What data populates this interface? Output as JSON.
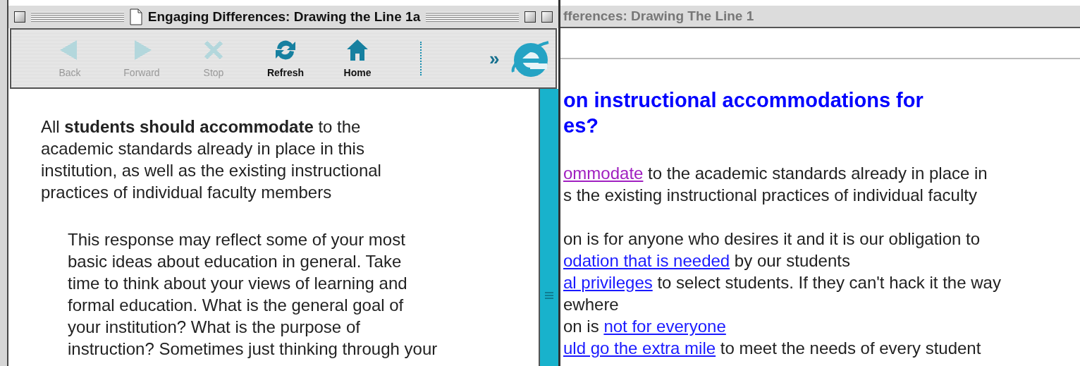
{
  "front_window": {
    "title": "Engaging Differences: Drawing the Line 1a",
    "toolbar": [
      {
        "kind": "back",
        "label": "Back",
        "disabled": true
      },
      {
        "kind": "forward",
        "label": "Forward",
        "disabled": true
      },
      {
        "kind": "stop",
        "label": "Stop",
        "disabled": true
      },
      {
        "kind": "refresh",
        "label": "Refresh",
        "disabled": false
      },
      {
        "kind": "home",
        "label": "Home",
        "disabled": false
      }
    ],
    "overflow": "»",
    "statement_lines": [
      "All **students should accommodate** to the",
      "academic standards already in place in this",
      "institution, as well as the existing instructional",
      "practices of individual faculty members"
    ],
    "response_lines": [
      "This response may reflect some of your most",
      "basic ideas about education in general. Take",
      "time to think about your views of learning and",
      "formal education. What is the general goal of",
      "your institution? What is the purpose of",
      "instruction? Sometimes just thinking through your"
    ]
  },
  "back_window": {
    "title": "fferences: Drawing The Line 1",
    "heading_lines": [
      "on instructional accommodations for",
      "es?"
    ],
    "paragraphs": [
      [
        [
          {
            "kind": "visited",
            "text": "ommodate"
          },
          {
            "kind": "text",
            "text": " to the academic standards already in place in"
          }
        ],
        [
          {
            "kind": "text",
            "text": "s the existing instructional practices of individual faculty"
          }
        ]
      ],
      [
        [
          {
            "kind": "text",
            "text": "on is for anyone who desires it and it is our obligation to"
          }
        ],
        [
          {
            "kind": "link",
            "text": "odation that is needed"
          },
          {
            "kind": "text",
            "text": " by our students"
          }
        ],
        [
          {
            "kind": "link",
            "text": "al privileges"
          },
          {
            "kind": "text",
            "text": " to select students. If they can't hack it the way"
          }
        ],
        [
          {
            "kind": "text",
            "text": "ewhere"
          }
        ],
        [
          {
            "kind": "text",
            "text": "on is "
          },
          {
            "kind": "link",
            "text": "not for everyone"
          }
        ],
        [
          {
            "kind": "link",
            "text": "uld go the extra mile"
          },
          {
            "kind": "text",
            "text": " to meet the needs of every student"
          }
        ]
      ]
    ]
  }
}
